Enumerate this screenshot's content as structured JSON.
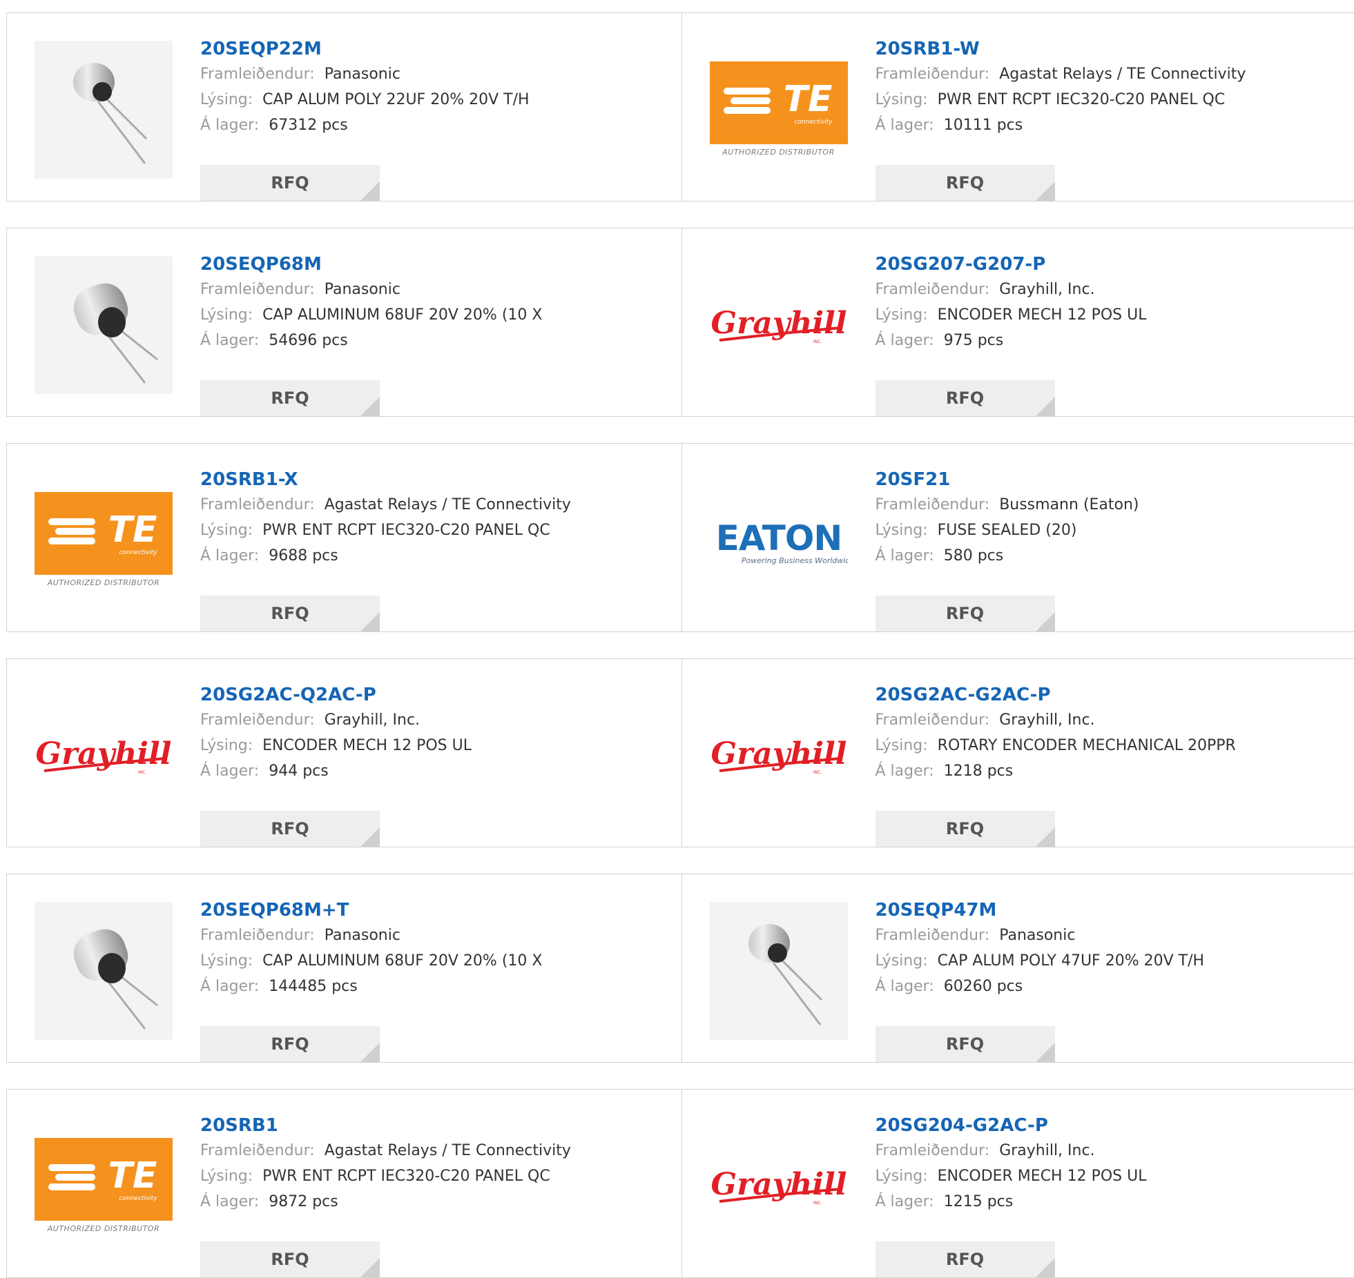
{
  "labels": {
    "manufacturer": "Framleiðendur:",
    "description": "Lýsing:",
    "stock": "Á lager:",
    "rfq": "RFQ"
  },
  "logo_text": {
    "te_brand": "TE",
    "te_sub": "connectivity",
    "te_authorized": "AUTHORIZED DISTRIBUTOR",
    "grayhill": "Grayhill",
    "grayhill_inc": "INC.",
    "eaton": "EATON",
    "eaton_tagline": "Powering Business Worldwide"
  },
  "colors": {
    "part_number": "#1565b5",
    "te_orange": "#f5921e",
    "grayhill_red": "#e21f26",
    "eaton_blue": "#1d6fb8"
  },
  "rows": [
    {
      "left": {
        "logo": "capacitor-small",
        "part": "20SEQP22M",
        "manufacturer": "Panasonic",
        "description": "CAP ALUM POLY 22UF 20% 20V T/H",
        "stock": "67312 pcs"
      },
      "right": {
        "logo": "te",
        "part": "20SRB1-W",
        "manufacturer": "Agastat Relays / TE Connectivity",
        "description": "PWR ENT RCPT IEC320-C20 PANEL QC",
        "stock": "10111 pcs"
      }
    },
    {
      "left": {
        "logo": "capacitor-large",
        "part": "20SEQP68M",
        "manufacturer": "Panasonic",
        "description": "CAP ALUMINUM 68UF 20V 20% (10 X",
        "stock": "54696 pcs"
      },
      "right": {
        "logo": "grayhill",
        "part": "20SG207-G207-P",
        "manufacturer": "Grayhill, Inc.",
        "description": "ENCODER MECH 12 POS UL",
        "stock": "975 pcs"
      }
    },
    {
      "left": {
        "logo": "te",
        "part": "20SRB1-X",
        "manufacturer": "Agastat Relays / TE Connectivity",
        "description": "PWR ENT RCPT IEC320-C20 PANEL QC",
        "stock": "9688 pcs"
      },
      "right": {
        "logo": "eaton",
        "part": "20SF21",
        "manufacturer": "Bussmann (Eaton)",
        "description": "FUSE SEALED (20)",
        "stock": "580 pcs"
      }
    },
    {
      "left": {
        "logo": "grayhill",
        "part": "20SG2AC-Q2AC-P",
        "manufacturer": "Grayhill, Inc.",
        "description": "ENCODER MECH 12 POS UL",
        "stock": "944 pcs"
      },
      "right": {
        "logo": "grayhill",
        "part": "20SG2AC-G2AC-P",
        "manufacturer": "Grayhill, Inc.",
        "description": "ROTARY ENCODER MECHANICAL 20PPR",
        "stock": "1218 pcs"
      }
    },
    {
      "left": {
        "logo": "capacitor-large",
        "part": "20SEQP68M+T",
        "manufacturer": "Panasonic",
        "description": "CAP ALUMINUM 68UF 20V 20% (10 X",
        "stock": "144485 pcs"
      },
      "right": {
        "logo": "capacitor-small",
        "part": "20SEQP47M",
        "manufacturer": "Panasonic",
        "description": "CAP ALUM POLY 47UF 20% 20V T/H",
        "stock": "60260 pcs"
      }
    },
    {
      "left": {
        "logo": "te",
        "part": "20SRB1",
        "manufacturer": "Agastat Relays / TE Connectivity",
        "description": "PWR ENT RCPT IEC320-C20 PANEL QC",
        "stock": "9872 pcs"
      },
      "right": {
        "logo": "grayhill",
        "part": "20SG204-G2AC-P",
        "manufacturer": "Grayhill, Inc.",
        "description": "ENCODER MECH 12 POS UL",
        "stock": "1215 pcs"
      }
    }
  ]
}
